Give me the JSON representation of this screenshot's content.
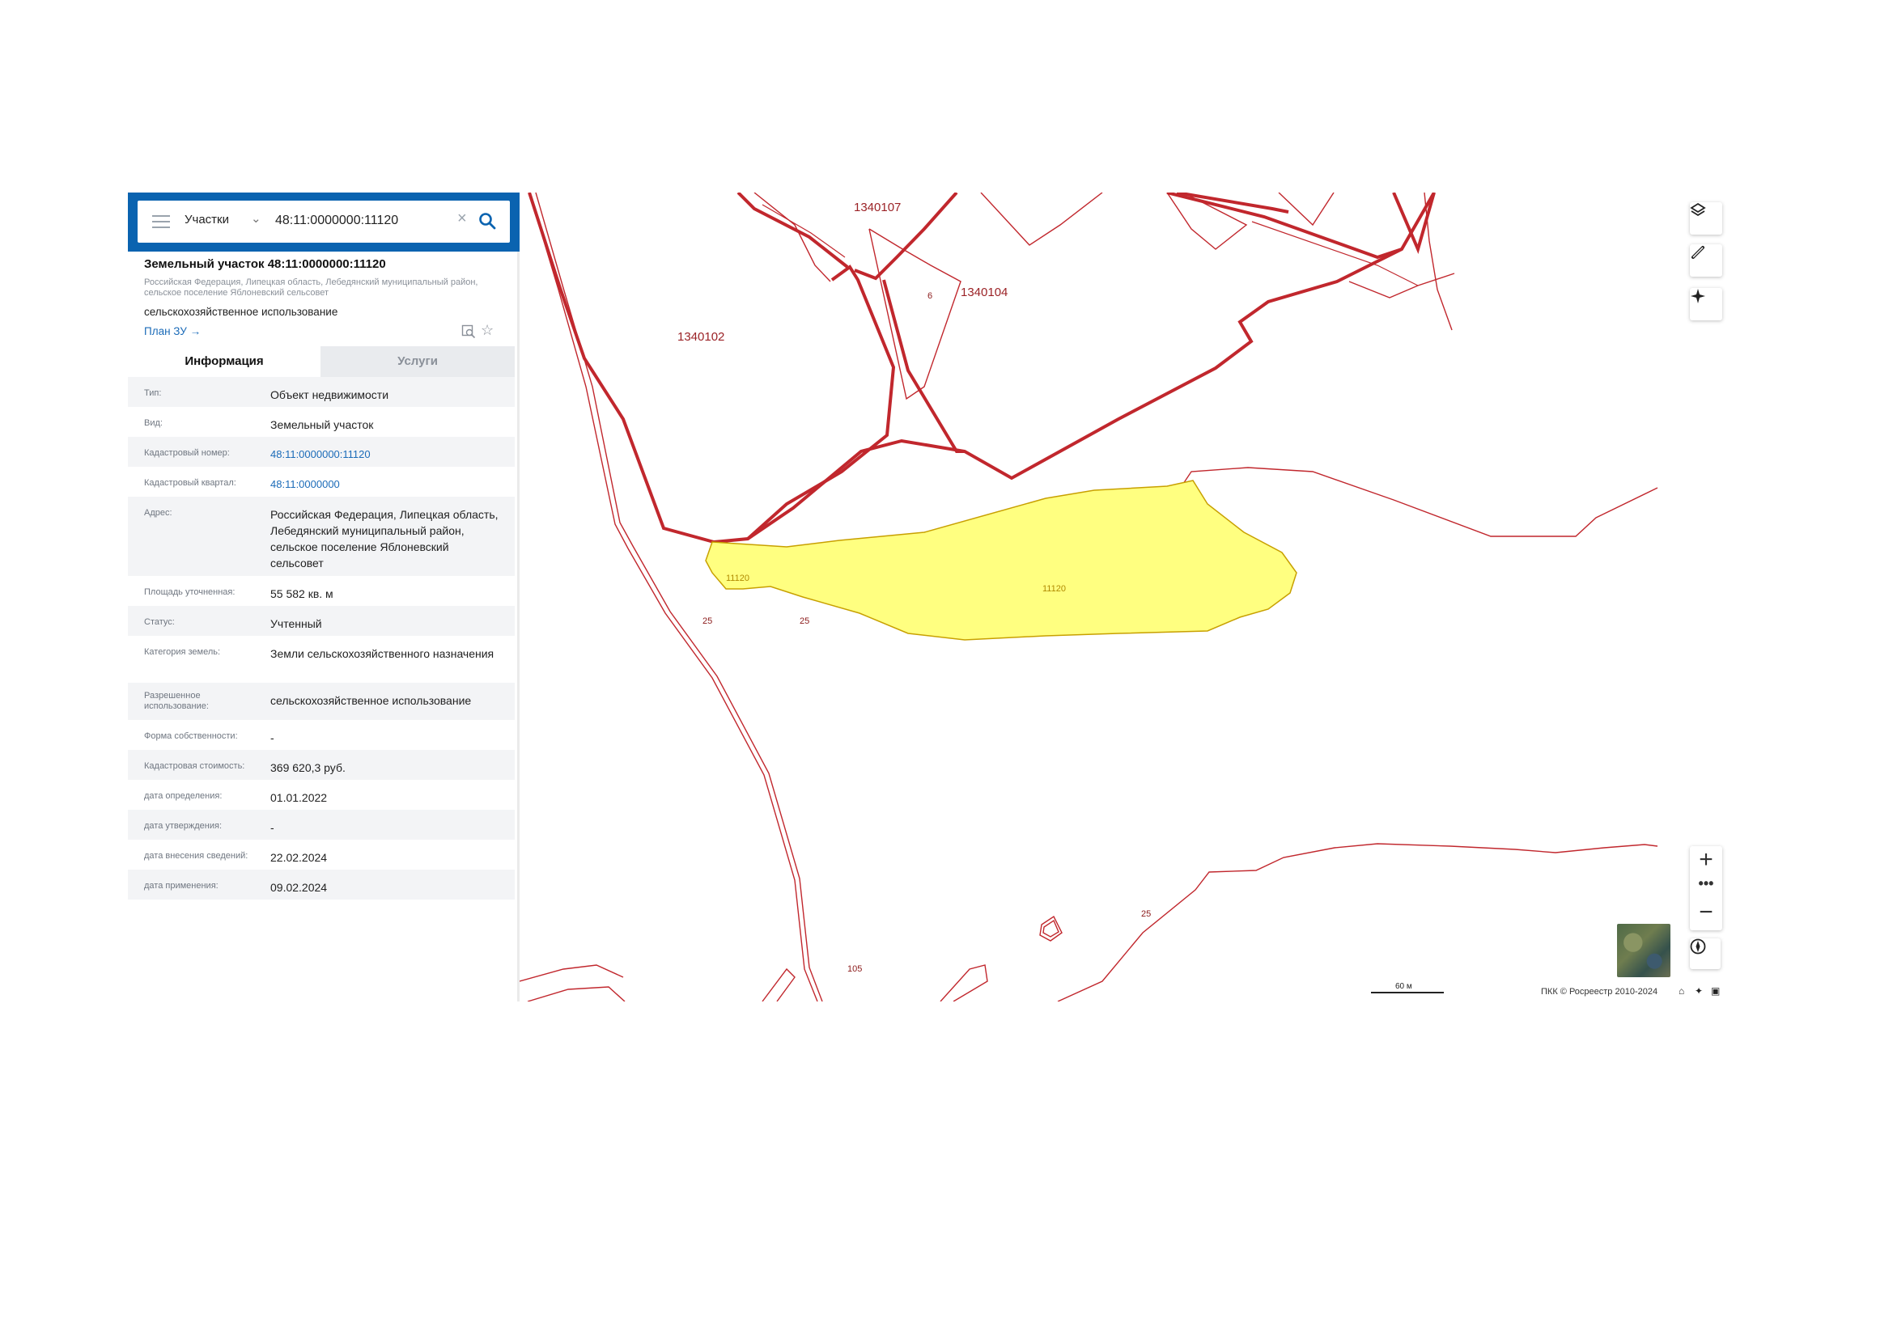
{
  "search": {
    "layer": "Участки",
    "query": "48:11:0000000:11120"
  },
  "object": {
    "title": "Земельный участок 48:11:0000000:11120",
    "address": "Российская Федерация, Липецкая область, Лебедянский муниципальный район, сельское поселение Яблоневский сельсовет",
    "use": "сельскохозяйственное использование",
    "plan_link": "План ЗУ →"
  },
  "tabs": [
    {
      "label": "Информация",
      "active": true
    },
    {
      "label": "Услуги",
      "active": false
    }
  ],
  "attributes": [
    {
      "key": "Тип:",
      "value": "Объект недвижимости"
    },
    {
      "key": "Вид:",
      "value": "Земельный участок"
    },
    {
      "key": "Кадастровый номер:",
      "value": "48:11:0000000:11120",
      "link": true
    },
    {
      "key": "Кадастровый квартал:",
      "value": "48:11:0000000",
      "link": true
    },
    {
      "key": "Адрес:",
      "value": "Российская Федерация, Липецкая область, Лебедянский муниципальный район, сельское поселение Яблоневский сельсовет"
    },
    {
      "key": "Площадь уточненная:",
      "value": "55 582 кв. м"
    },
    {
      "key": "Статус:",
      "value": "Учтенный"
    },
    {
      "key": "Категория земель:",
      "value": "Земли сельскохозяйственного назначения"
    },
    {
      "key": "Разрешенное использование:",
      "value": "сельскохозяйственное использование"
    },
    {
      "key": "Форма собственности:",
      "value": "-"
    },
    {
      "key": "Кадастровая стоимость:",
      "value": "369 620,3 руб."
    },
    {
      "key": "дата определения:",
      "value": "01.01.2022"
    },
    {
      "key": "дата утверждения:",
      "value": "-"
    },
    {
      "key": "дата внесения сведений:",
      "value": "22.02.2024"
    },
    {
      "key": "дата применения:",
      "value": "09.02.2024"
    }
  ],
  "map": {
    "labels": {
      "q1340107": "1340107",
      "q1340104": "1340104",
      "q1340102": "1340102",
      "p11120a": "11120",
      "p11120b": "11120",
      "n25a": "25",
      "n25b": "25",
      "n25c": "25",
      "n105": "105",
      "n6": "6"
    },
    "scale": "60 м",
    "attribution": "ПКК © Росреестр 2010-2024",
    "colors": {
      "parcel_border": "#c1272d",
      "selected_fill": "#ffff80",
      "selected_border": "#c8a000",
      "header": "#0a63b0",
      "link": "#1b6bb8"
    }
  },
  "icons": [
    "menu-icon",
    "chevron-down-icon",
    "clear-icon",
    "search-icon",
    "collapse-icon",
    "preview-icon",
    "star-icon",
    "layers-icon",
    "ruler-icon",
    "locate-icon",
    "compass-icon",
    "home-icon",
    "fullscreen-icon"
  ]
}
